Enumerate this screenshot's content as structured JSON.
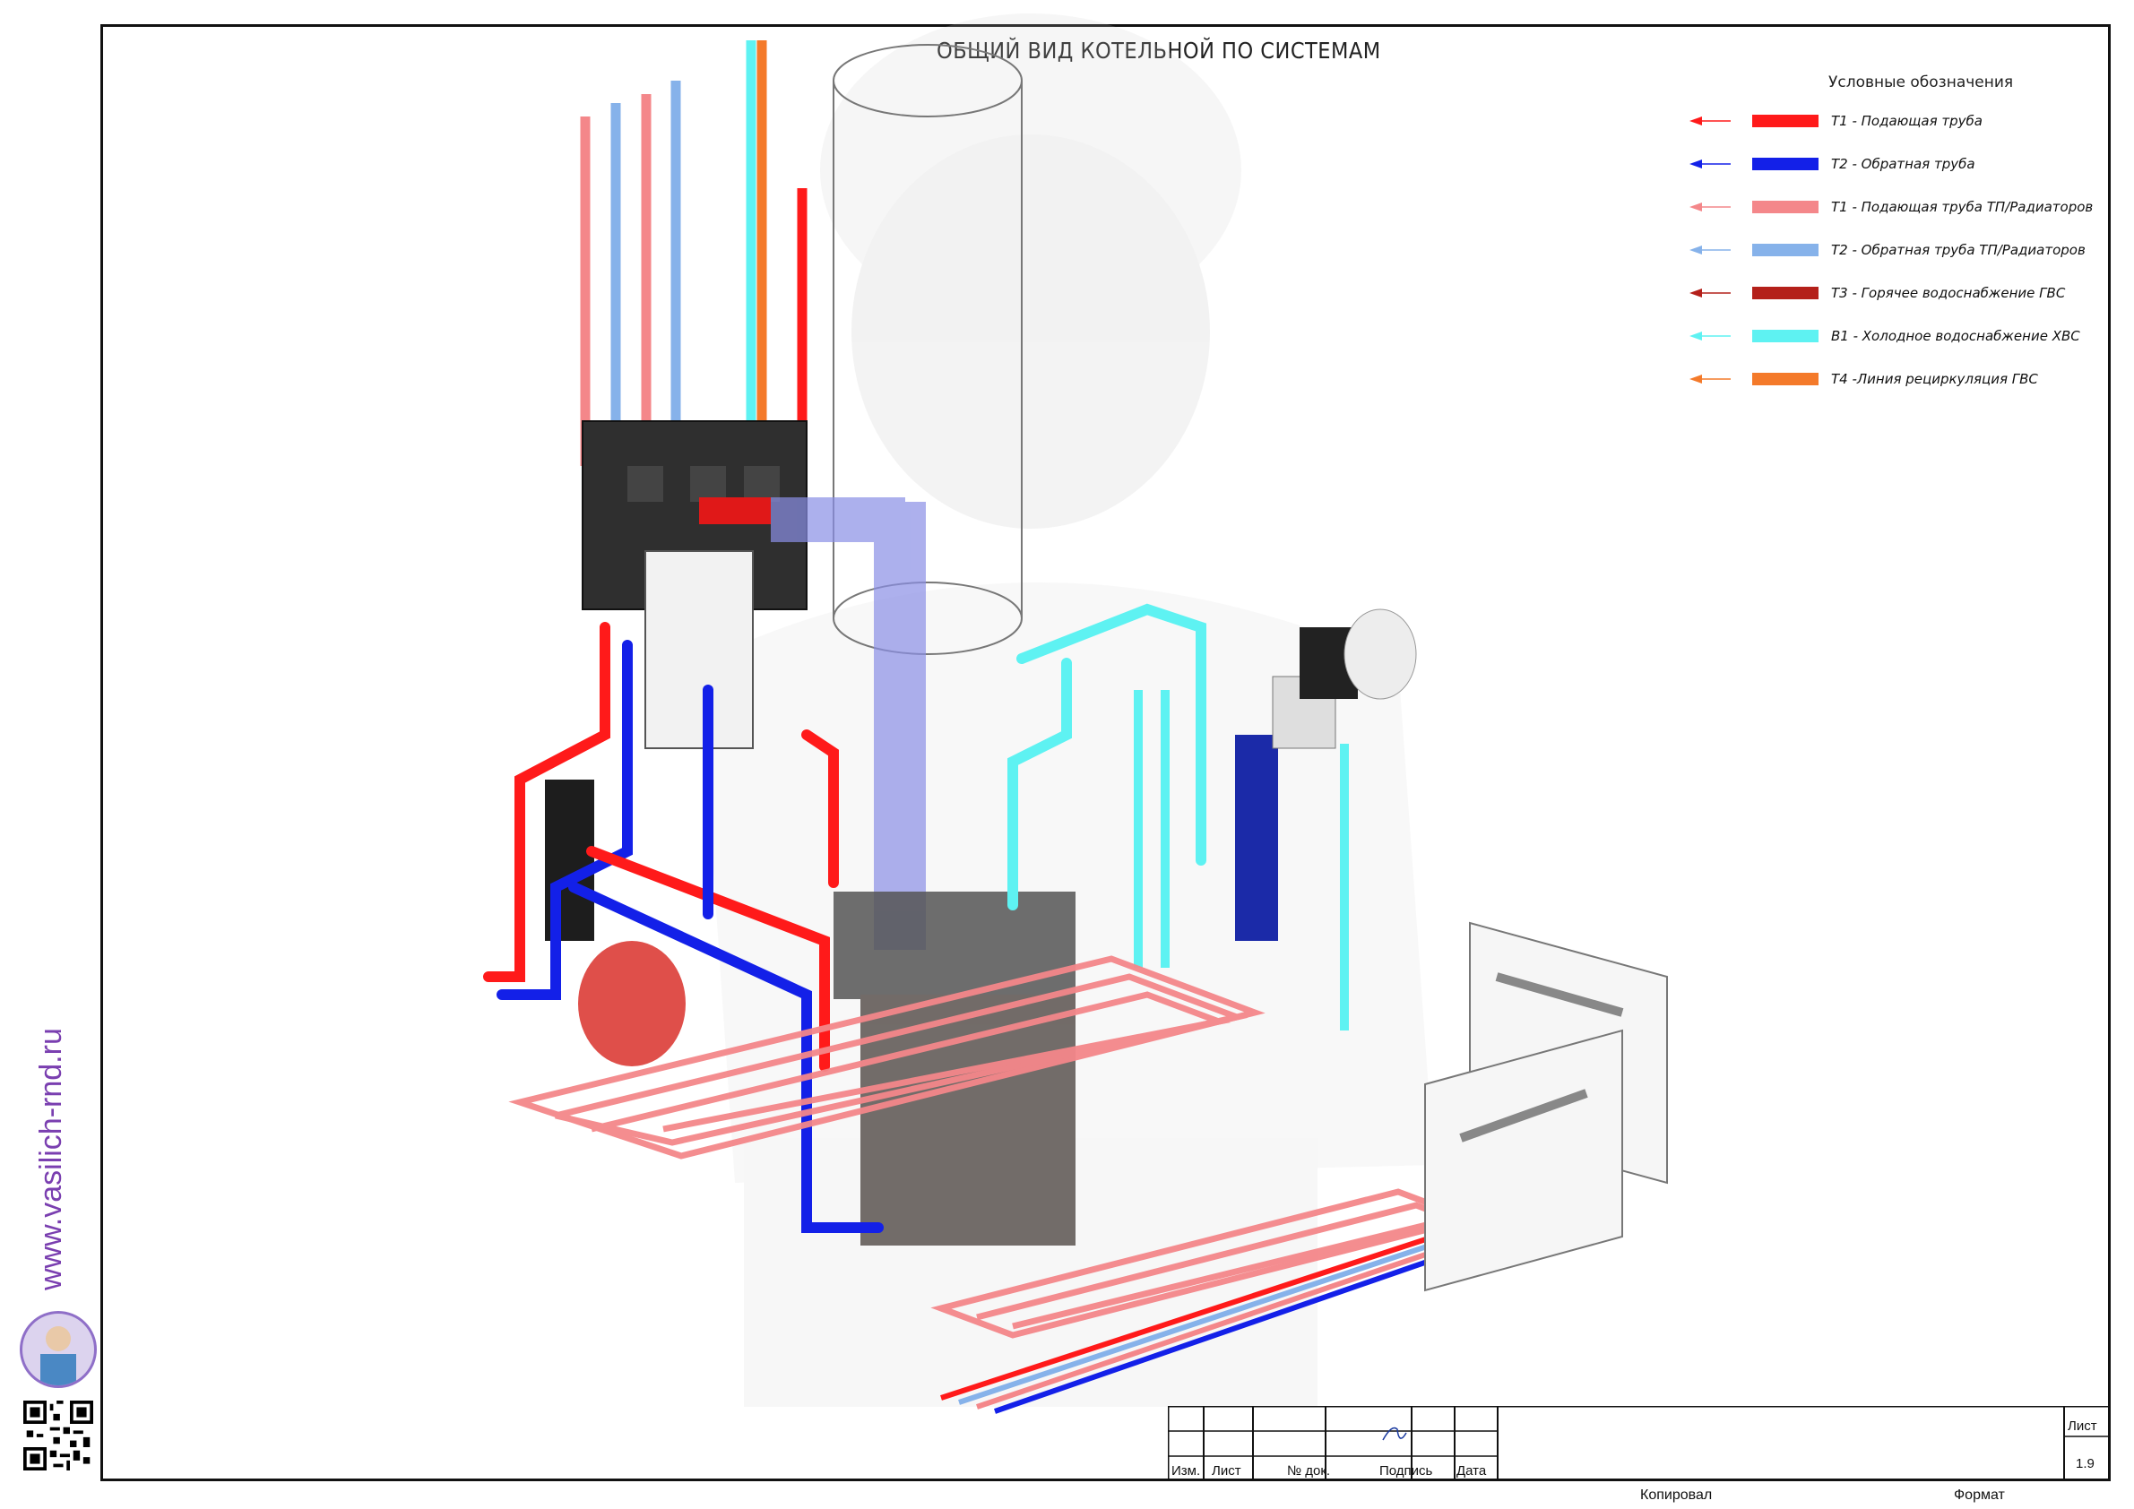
{
  "title": "ОБЩИЙ ВИД КОТЕЛЬНОЙ ПО СИСТЕМАМ",
  "legend": {
    "heading": "Условные обозначения",
    "items": [
      {
        "label": "Т1 - Подающая труба",
        "color": "#ff1a1a"
      },
      {
        "label": "Т2 - Обратная труба",
        "color": "#1320e8"
      },
      {
        "label": "Т1 - Подающая труба ТП/Радиаторов",
        "color": "#f4878a"
      },
      {
        "label": "Т2 - Обратная труба ТП/Радиаторов",
        "color": "#86b2ea"
      },
      {
        "label": "Т3 - Горячее водоснабжение ГВС",
        "color": "#b4201a"
      },
      {
        "label": "В1 - Холодное водоснабжение ХВС",
        "color": "#5ef2f2"
      },
      {
        "label": "Т4 -Линия  рециркуляция ГВС",
        "color": "#f47a2a"
      }
    ]
  },
  "sidebar": {
    "url": "www.vasilich-rnd.ru"
  },
  "stamp": {
    "columns": [
      "Изм.",
      "Лист",
      "№ док.",
      "Подпись",
      "Дата"
    ],
    "sheet_label": "Лист",
    "sheet_number": "1.9",
    "copied_label": "Копировал",
    "format_label": "Формат"
  }
}
